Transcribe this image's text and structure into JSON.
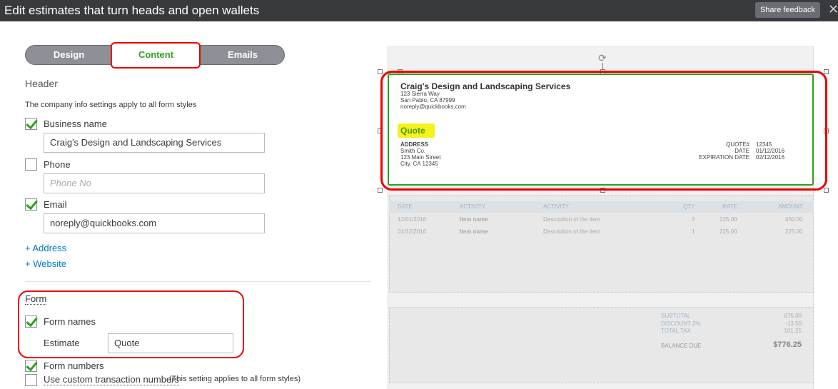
{
  "header": {
    "title": "Edit estimates that turn heads and open wallets",
    "feedback": "Share feedback",
    "close": "✕"
  },
  "tabs": [
    {
      "label": "Design"
    },
    {
      "label": "Content"
    },
    {
      "label": "Emails"
    }
  ],
  "section_header": {
    "title": "Header",
    "note": "The company info settings apply to all form styles",
    "business_name": {
      "label": "Business name",
      "checked": true,
      "value": "Craig's Design and Landscaping Services"
    },
    "phone": {
      "label": "Phone",
      "checked": false,
      "placeholder": "Phone No"
    },
    "email": {
      "label": "Email",
      "checked": true,
      "value": "noreply@quickbooks.com"
    },
    "add_address": "+ Address",
    "add_website": "+ Website"
  },
  "section_form": {
    "title": "Form",
    "form_names": {
      "label": "Form names",
      "checked": true
    },
    "estimate_label": "Estimate",
    "estimate_value": "Quote",
    "form_numbers": {
      "label": "Form numbers",
      "checked": true
    },
    "custom_numbers": {
      "label": "Use custom transaction numbers",
      "note": "(This setting applies to all form styles)",
      "checked": false
    }
  },
  "preview": {
    "company": "Craig's Design and Landscaping Services",
    "addr1": "123 Sierra Way",
    "addr2": "San Pablo, CA 87999",
    "email": "noreply@quickbooks.com",
    "form_name": "Quote",
    "address_label": "ADDRESS",
    "cust1": "Smith Co.",
    "cust2": "123 Main Street",
    "cust3": "City, CA 12345",
    "meta": [
      {
        "label": "QUOTE#",
        "value": "12345"
      },
      {
        "label": "DATE",
        "value": "01/12/2016"
      },
      {
        "label": "EXPIRATION DATE",
        "value": "02/12/2016"
      }
    ],
    "columns": [
      "DATE",
      "ACTIVITY",
      "ACTIVITY",
      "QTY",
      "RATE",
      "AMOUNT"
    ],
    "rows": [
      [
        "12/01/2016",
        "Item name",
        "Description of the item",
        "2",
        "225.00",
        "450.00"
      ],
      [
        "01/12/2016",
        "Item name",
        "Description of the item",
        "1",
        "225.00",
        "225.00"
      ]
    ],
    "subtotal_label": "SUBTOTAL",
    "subtotal": "675.00",
    "discount_label": "DISCOUNT 2%",
    "discount": "-13.50",
    "tax_label": "TOTAL TAX",
    "tax": "101.25",
    "balance_label": "BALANCE DUE",
    "balance": "$776.25"
  }
}
